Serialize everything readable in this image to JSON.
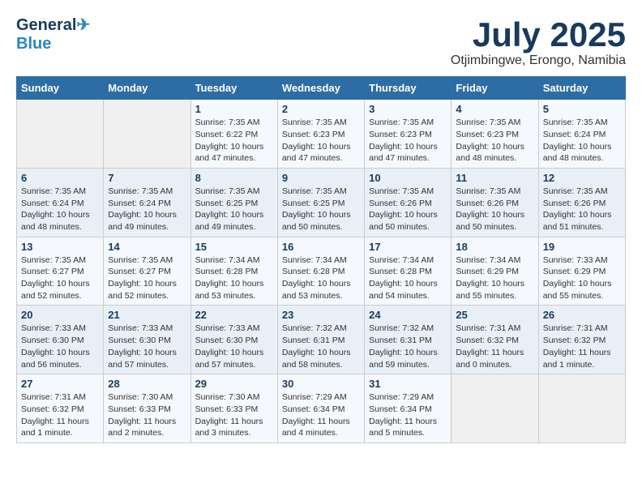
{
  "logo": {
    "line1": "General",
    "line2": "Blue"
  },
  "title": "July 2025",
  "subtitle": "Otjimbingwe, Erongo, Namibia",
  "days_header": [
    "Sunday",
    "Monday",
    "Tuesday",
    "Wednesday",
    "Thursday",
    "Friday",
    "Saturday"
  ],
  "weeks": [
    [
      {
        "day": "",
        "text": ""
      },
      {
        "day": "",
        "text": ""
      },
      {
        "day": "1",
        "text": "Sunrise: 7:35 AM\nSunset: 6:22 PM\nDaylight: 10 hours\nand 47 minutes."
      },
      {
        "day": "2",
        "text": "Sunrise: 7:35 AM\nSunset: 6:23 PM\nDaylight: 10 hours\nand 47 minutes."
      },
      {
        "day": "3",
        "text": "Sunrise: 7:35 AM\nSunset: 6:23 PM\nDaylight: 10 hours\nand 47 minutes."
      },
      {
        "day": "4",
        "text": "Sunrise: 7:35 AM\nSunset: 6:23 PM\nDaylight: 10 hours\nand 48 minutes."
      },
      {
        "day": "5",
        "text": "Sunrise: 7:35 AM\nSunset: 6:24 PM\nDaylight: 10 hours\nand 48 minutes."
      }
    ],
    [
      {
        "day": "6",
        "text": "Sunrise: 7:35 AM\nSunset: 6:24 PM\nDaylight: 10 hours\nand 48 minutes."
      },
      {
        "day": "7",
        "text": "Sunrise: 7:35 AM\nSunset: 6:24 PM\nDaylight: 10 hours\nand 49 minutes."
      },
      {
        "day": "8",
        "text": "Sunrise: 7:35 AM\nSunset: 6:25 PM\nDaylight: 10 hours\nand 49 minutes."
      },
      {
        "day": "9",
        "text": "Sunrise: 7:35 AM\nSunset: 6:25 PM\nDaylight: 10 hours\nand 50 minutes."
      },
      {
        "day": "10",
        "text": "Sunrise: 7:35 AM\nSunset: 6:26 PM\nDaylight: 10 hours\nand 50 minutes."
      },
      {
        "day": "11",
        "text": "Sunrise: 7:35 AM\nSunset: 6:26 PM\nDaylight: 10 hours\nand 50 minutes."
      },
      {
        "day": "12",
        "text": "Sunrise: 7:35 AM\nSunset: 6:26 PM\nDaylight: 10 hours\nand 51 minutes."
      }
    ],
    [
      {
        "day": "13",
        "text": "Sunrise: 7:35 AM\nSunset: 6:27 PM\nDaylight: 10 hours\nand 52 minutes."
      },
      {
        "day": "14",
        "text": "Sunrise: 7:35 AM\nSunset: 6:27 PM\nDaylight: 10 hours\nand 52 minutes."
      },
      {
        "day": "15",
        "text": "Sunrise: 7:34 AM\nSunset: 6:28 PM\nDaylight: 10 hours\nand 53 minutes."
      },
      {
        "day": "16",
        "text": "Sunrise: 7:34 AM\nSunset: 6:28 PM\nDaylight: 10 hours\nand 53 minutes."
      },
      {
        "day": "17",
        "text": "Sunrise: 7:34 AM\nSunset: 6:28 PM\nDaylight: 10 hours\nand 54 minutes."
      },
      {
        "day": "18",
        "text": "Sunrise: 7:34 AM\nSunset: 6:29 PM\nDaylight: 10 hours\nand 55 minutes."
      },
      {
        "day": "19",
        "text": "Sunrise: 7:33 AM\nSunset: 6:29 PM\nDaylight: 10 hours\nand 55 minutes."
      }
    ],
    [
      {
        "day": "20",
        "text": "Sunrise: 7:33 AM\nSunset: 6:30 PM\nDaylight: 10 hours\nand 56 minutes."
      },
      {
        "day": "21",
        "text": "Sunrise: 7:33 AM\nSunset: 6:30 PM\nDaylight: 10 hours\nand 57 minutes."
      },
      {
        "day": "22",
        "text": "Sunrise: 7:33 AM\nSunset: 6:30 PM\nDaylight: 10 hours\nand 57 minutes."
      },
      {
        "day": "23",
        "text": "Sunrise: 7:32 AM\nSunset: 6:31 PM\nDaylight: 10 hours\nand 58 minutes."
      },
      {
        "day": "24",
        "text": "Sunrise: 7:32 AM\nSunset: 6:31 PM\nDaylight: 10 hours\nand 59 minutes."
      },
      {
        "day": "25",
        "text": "Sunrise: 7:31 AM\nSunset: 6:32 PM\nDaylight: 11 hours\nand 0 minutes."
      },
      {
        "day": "26",
        "text": "Sunrise: 7:31 AM\nSunset: 6:32 PM\nDaylight: 11 hours\nand 1 minute."
      }
    ],
    [
      {
        "day": "27",
        "text": "Sunrise: 7:31 AM\nSunset: 6:32 PM\nDaylight: 11 hours\nand 1 minute."
      },
      {
        "day": "28",
        "text": "Sunrise: 7:30 AM\nSunset: 6:33 PM\nDaylight: 11 hours\nand 2 minutes."
      },
      {
        "day": "29",
        "text": "Sunrise: 7:30 AM\nSunset: 6:33 PM\nDaylight: 11 hours\nand 3 minutes."
      },
      {
        "day": "30",
        "text": "Sunrise: 7:29 AM\nSunset: 6:34 PM\nDaylight: 11 hours\nand 4 minutes."
      },
      {
        "day": "31",
        "text": "Sunrise: 7:29 AM\nSunset: 6:34 PM\nDaylight: 11 hours\nand 5 minutes."
      },
      {
        "day": "",
        "text": ""
      },
      {
        "day": "",
        "text": ""
      }
    ]
  ]
}
